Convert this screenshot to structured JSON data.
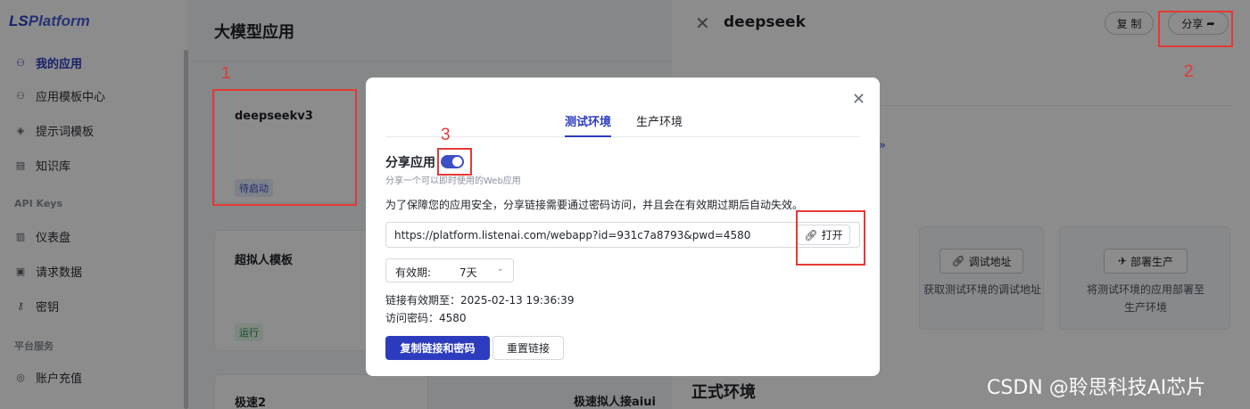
{
  "sidebar": {
    "logo_prefix": "LS",
    "logo_suffix": "Platform",
    "items": [
      {
        "label": "我的应用",
        "icon": "apps-icon",
        "active": true
      },
      {
        "label": "应用模板中心",
        "icon": "template-icon"
      },
      {
        "label": "提示词模板",
        "icon": "cube-icon"
      },
      {
        "label": "知识库",
        "icon": "book-icon"
      }
    ],
    "section_api": "API Keys",
    "api_items": [
      {
        "label": "仪表盘",
        "icon": "bar-chart-icon"
      },
      {
        "label": "请求数据",
        "icon": "document-icon"
      },
      {
        "label": "密钥",
        "icon": "key-icon"
      }
    ],
    "section_platform": "平台服务",
    "platform_items": [
      {
        "label": "账户充值",
        "icon": "wallet-icon"
      }
    ]
  },
  "main": {
    "title": "大模型应用",
    "cards": [
      {
        "title": "deepseekv3",
        "badge": "待启动"
      },
      {
        "title": "超拟人模板",
        "badge": "运行"
      },
      {
        "title": "极速2"
      },
      {
        "title": "极速拟人接aiui"
      }
    ]
  },
  "drawer": {
    "title": "deepseek",
    "copy_label": "复 制",
    "share_label": "分享",
    "link_fragment": "»",
    "env_cards": [
      {
        "button": "调试地址",
        "desc": "获取测试环境的调试地址"
      },
      {
        "button": "部署生产",
        "desc_line1": "将测试环境的应用部署至",
        "desc_line2": "生产环境"
      }
    ],
    "section_title": "正式环境"
  },
  "modal": {
    "tabs": [
      "测试环境",
      "生产环境"
    ],
    "share_title": "分享应用",
    "share_subtitle": "分享一个可以即时使用的Web应用",
    "notice": "为了保障您的应用安全，分享链接需要通过密码访问，并且会在有效期过期后自动失效。",
    "url": "https://platform.listenai.com/webapp?id=931c7a8793&pwd=4580",
    "open_label": "打开",
    "validity_label": "有效期:",
    "validity_value": "7天",
    "expiry_line": "链接有效期至：2025-02-13 19:36:39",
    "password_line": "访问密码：4580",
    "copy_button": "复制链接和密码",
    "reset_button": "重置链接",
    "share_enabled": true
  },
  "annotations": [
    "1",
    "2",
    "3"
  ],
  "watermark": "CSDN @聆思科技AI芯片",
  "colors": {
    "accent": "#2d3cbf",
    "annotation": "#e53935"
  }
}
